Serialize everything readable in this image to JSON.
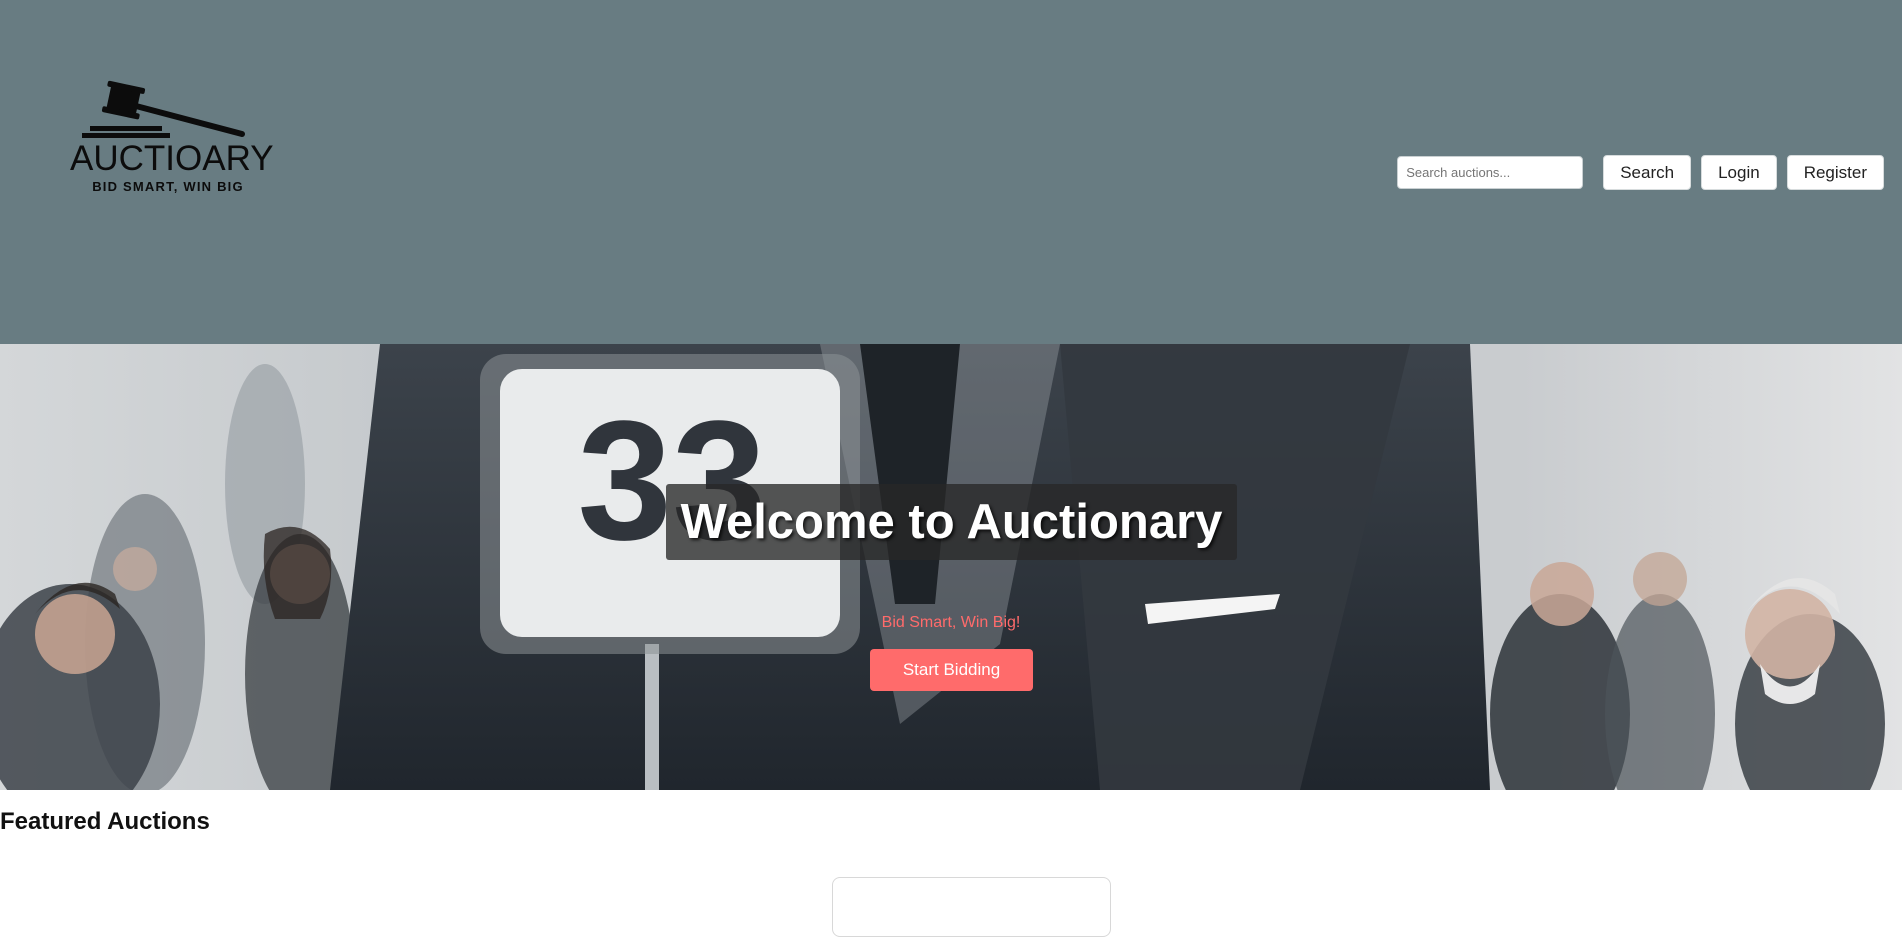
{
  "brand": {
    "name": "AUCTIOARY",
    "tagline": "BID SMART, WIN BIG",
    "logo_icon": "gavel-icon"
  },
  "header": {
    "background": "#687c82",
    "search": {
      "placeholder": "Search auctions...",
      "value": ""
    },
    "search_label": "Search",
    "login_label": "Login",
    "register_label": "Register"
  },
  "hero": {
    "title": "Welcome to Auctionary",
    "subtitle": "Bid Smart, Win Big!",
    "cta_label": "Start Bidding",
    "paddle_number": "33",
    "accent": "#ff6b6b"
  },
  "featured": {
    "heading": "Featured Auctions"
  }
}
